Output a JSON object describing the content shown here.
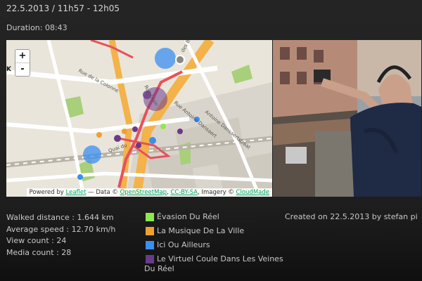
{
  "header": {
    "title": "22.5.2013 / 11h57 - 12h05",
    "duration": "Duration: 08:43"
  },
  "map": {
    "zoom_in": "+",
    "zoom_out": "-",
    "edge_letter": "K",
    "street_labels": [
      "Rue de la Colonne",
      "Rue Antoine Dansaert",
      "Antoine Dansaertstraat",
      "Quai du",
      "Rue Léon",
      "des Briques"
    ],
    "attribution": {
      "prefix": "Powered by",
      "leaflet": "Leaflet",
      "data_prefix": " — Data ©",
      "osm": "OpenStreetMap",
      "license": "CC-BY-SA",
      "imagery": ", Imagery ©",
      "cloudmade": "CloudMade"
    }
  },
  "stats": {
    "walked": "Walked distance : 1.644 km",
    "speed": "Average speed : 12.70 km/h",
    "views": "View count : 24",
    "media": "Media count : 28"
  },
  "legend": [
    {
      "label": "Évasion Du Réel",
      "color": "#8ee84a"
    },
    {
      "label": "La Musique De La Ville",
      "color": "#f0a030"
    },
    {
      "label": "Ici Ou Ailleurs",
      "color": "#3a8ff0"
    },
    {
      "label": "Le Virtuel Coule Dans Les Veines Du Réel",
      "color": "#6a3a8a"
    }
  ],
  "created": "Created on 22.5.2013 by stefan pi"
}
